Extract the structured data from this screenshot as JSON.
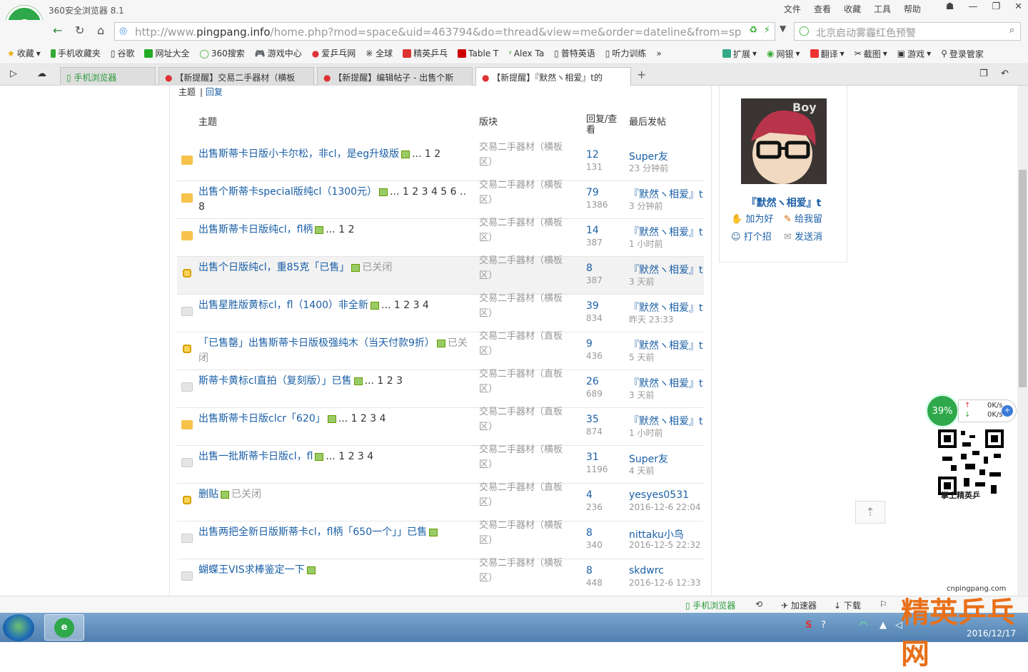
{
  "window": {
    "title": "360安全浏览器 8.1"
  },
  "menu": [
    "文件",
    "查看",
    "收藏",
    "工具",
    "帮助"
  ],
  "address": {
    "url_prefix": "http://www.",
    "url_domain": "pingpang.info",
    "url_rest": "/home.php?mod=space&uid=463794&do=thread&view=me&order=dateline&from=spac",
    "search_placeholder": "北京启动雾霾红色预警"
  },
  "bookmarks": [
    "收藏",
    "手机收藏夹",
    "谷歌",
    "网址大全",
    "360搜索",
    "游戏中心",
    "爱乒乓网",
    "※ 全球",
    "精英乒乓",
    "Table T",
    "Alex Ta",
    "普特英语",
    "听力训练"
  ],
  "toolbar_right": [
    "扩展",
    "网银",
    "翻译",
    "截图",
    "游戏",
    "登录管家"
  ],
  "tabs": [
    {
      "label": "手机浏览器"
    },
    {
      "label": "【新提醒】交易二手器材（横板"
    },
    {
      "label": "【新提醒】编辑帖子 - 出售个斯"
    },
    {
      "label": "【新提醒】『默然ヽ相爱』t的"
    }
  ],
  "subtabs": [
    "主题",
    "回复"
  ],
  "columns": {
    "subject": "主题",
    "forum": "版块",
    "replies": "回复/查看",
    "last": "最后发帖"
  },
  "rows": [
    {
      "subject": "出售斯蒂卡日版小卡尔松，非cl，是eg升级版",
      "pages": "... 1  2",
      "closed": "",
      "forum": "交易二手器材（横板区）",
      "replies": "12",
      "views": "131",
      "last": "Super友",
      "time": "23 分钟前",
      "icon": "yellow"
    },
    {
      "subject": "出售个斯蒂卡special版纯cl（1300元）",
      "pages": "... 1  2  3  4  5  6 .. 8",
      "closed": "",
      "forum": "交易二手器材（横板区）",
      "replies": "79",
      "views": "1386",
      "last": "『默然ヽ相爱』t",
      "time": "3 分钟前",
      "icon": "yellow"
    },
    {
      "subject": "出售斯蒂卡日版纯cl，fl柄",
      "pages": "... 1  2",
      "closed": "",
      "forum": "交易二手器材（横板区）",
      "replies": "14",
      "views": "387",
      "last": "『默然ヽ相爱』t",
      "time": "1 小时前",
      "icon": "yellow"
    },
    {
      "subject": "出售个日版纯cl，重85克「已售」",
      "pages": "",
      "closed": "已关闭",
      "forum": "交易二手器材（横板区）",
      "replies": "8",
      "views": "387",
      "last": "『默然ヽ相爱』t",
      "time": "3 天前",
      "icon": "lock"
    },
    {
      "subject": "出售星胜版黄标cl，fl（1400）非全新",
      "pages": "... 1  2  3  4",
      "closed": "",
      "forum": "交易二手器材（横板区）",
      "replies": "39",
      "views": "834",
      "last": "『默然ヽ相爱』t",
      "time": "昨天 23:33",
      "icon": "gray"
    },
    {
      "subject": "「已售罄」出售斯蒂卡日版极强纯木（当天付款9折）",
      "pages": "",
      "closed": "已关闭",
      "forum": "交易二手器材（直板区）",
      "replies": "9",
      "views": "436",
      "last": "『默然ヽ相爱』t",
      "time": "5 天前",
      "icon": "lock"
    },
    {
      "subject": "斯蒂卡黄标cl直拍（复刻版）」已售",
      "pages": "... 1  2  3",
      "closed": "",
      "forum": "交易二手器材（直板区）",
      "replies": "26",
      "views": "689",
      "last": "『默然ヽ相爱』t",
      "time": "3 天前",
      "icon": "gray"
    },
    {
      "subject": "出售斯蒂卡日版clcr「620」",
      "pages": "... 1  2  3  4",
      "closed": "",
      "forum": "交易二手器材（直板区）",
      "replies": "35",
      "views": "874",
      "last": "『默然ヽ相爱』t",
      "time": "1 小时前",
      "icon": "yellow"
    },
    {
      "subject": "出售一批斯蒂卡日版cl，fl",
      "pages": "... 1  2  3  4",
      "closed": "",
      "forum": "交易二手器材（横板区）",
      "replies": "31",
      "views": "1196",
      "last": "Super友",
      "time": "4 天前",
      "icon": "gray"
    },
    {
      "subject": "删贴",
      "pages": "",
      "closed": "已关闭",
      "forum": "交易二手器材（直板区）",
      "replies": "4",
      "views": "236",
      "last": "yesyes0531",
      "time": "2016-12-6 22:04",
      "icon": "lock"
    },
    {
      "subject": "出售两把全新日版斯蒂卡cl，fl柄「650一个」」已售",
      "pages": "",
      "closed": "",
      "forum": "交易二手器材（横板区）",
      "replies": "8",
      "views": "340",
      "last": "nittaku小鸟",
      "time": "2016-12-5 22:32",
      "icon": "gray"
    },
    {
      "subject": "蝴蝶王VIS求棒鉴定一下",
      "pages": "",
      "closed": "",
      "forum": "交易二手器材（横板区）",
      "replies": "8",
      "views": "448",
      "last": "skdwrc",
      "time": "2016-12-6 12:33",
      "icon": "gray"
    }
  ],
  "profile": {
    "name": "『默然ヽ相爱』t",
    "avatar_text": "Boy",
    "actions": [
      "加为好",
      "给我留",
      "打个招",
      "发送消"
    ]
  },
  "widget": {
    "percent": "39%",
    "up": "0K/s",
    "down": "0K/s",
    "site": "cnpingpang.com",
    "qr_caption": "掌上精英乒"
  },
  "statusbar": [
    "手机浏览器",
    "加速器",
    "下载"
  ],
  "taskbar": {
    "date": "2016/12/17"
  },
  "watermark": "精英乒乓网"
}
